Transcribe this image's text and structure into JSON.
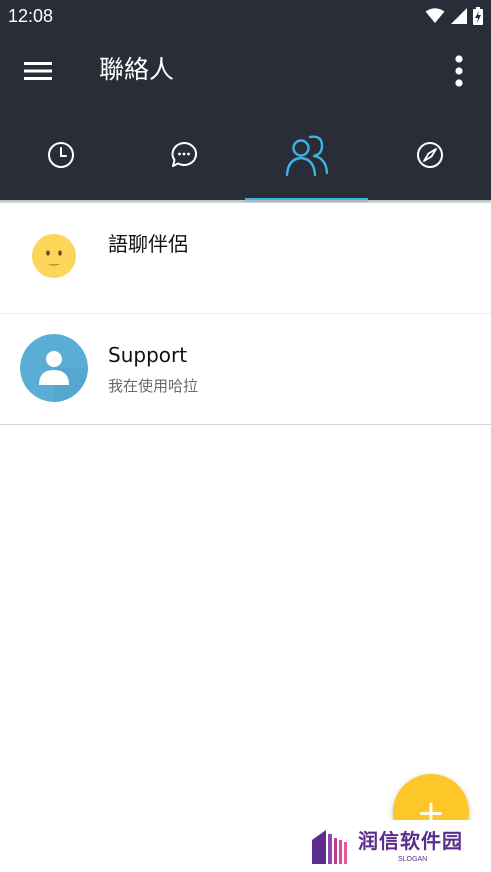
{
  "status_bar": {
    "time": "12:08",
    "icons": [
      "wifi-icon",
      "signal-icon",
      "battery-charging-icon"
    ]
  },
  "app_bar": {
    "title": "聯絡人",
    "menu_icon": "hamburger-menu-icon",
    "overflow_icon": "more-vertical-icon"
  },
  "tabs": [
    {
      "icon": "clock-icon",
      "selected": false
    },
    {
      "icon": "chat-bubble-icon",
      "selected": false
    },
    {
      "icon": "contacts-icon",
      "selected": true
    },
    {
      "icon": "compass-icon",
      "selected": false
    }
  ],
  "contacts": [
    {
      "name": "語聊伴侶",
      "subtitle": "",
      "avatar": "smiley-face-icon"
    },
    {
      "name": "Support",
      "subtitle": "我在使用哈拉",
      "avatar": "person-icon"
    }
  ],
  "fab": {
    "label": "+",
    "icon": "plus-icon"
  },
  "watermark": {
    "text": "润信软件园",
    "slogan": "SLOGAN"
  },
  "colors": {
    "app_bar": "#282d38",
    "accent": "#3bb3e6",
    "fab": "#fdc72a",
    "smiley": "#fdd55a",
    "support_avatar": "#5aaed6",
    "watermark": "#5b2d8c"
  }
}
